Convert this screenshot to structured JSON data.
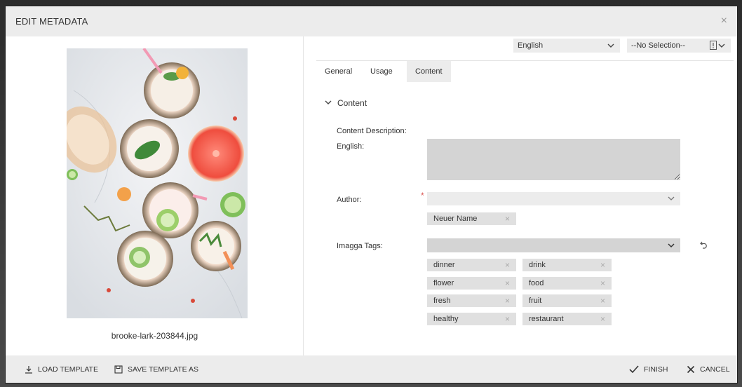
{
  "dialog": {
    "title": "EDIT METADATA",
    "close_icon": "×"
  },
  "preview": {
    "filename": "brooke-lark-203844.jpg"
  },
  "language_select": {
    "value": "English",
    "icon": "chevron-down-icon"
  },
  "selection_select": {
    "value": "--No Selection--",
    "icon": "alert-icon"
  },
  "tabs": [
    {
      "label": "General",
      "active": false
    },
    {
      "label": "Usage",
      "active": false
    },
    {
      "label": "Content",
      "active": true
    }
  ],
  "section": {
    "title": "Content",
    "icon": "chevron-down-icon"
  },
  "content_description": {
    "label": "Content Description:",
    "language_label": "English:",
    "value": ""
  },
  "author": {
    "label": "Author:",
    "value": "",
    "required_mark": "*",
    "tags": [
      {
        "label": "Neuer Name"
      }
    ]
  },
  "imagga": {
    "label": "Imagga Tags:",
    "value": "",
    "reset_icon": "undo-icon",
    "tags": [
      {
        "label": "dinner"
      },
      {
        "label": "drink"
      },
      {
        "label": "flower"
      },
      {
        "label": "food"
      },
      {
        "label": "fresh"
      },
      {
        "label": "fruit"
      },
      {
        "label": "healthy"
      },
      {
        "label": "restaurant"
      }
    ]
  },
  "footer": {
    "load_template": "LOAD TEMPLATE",
    "save_template": "SAVE TEMPLATE AS",
    "finish": "FINISH",
    "cancel": "CANCEL"
  },
  "remove_icon": "×"
}
